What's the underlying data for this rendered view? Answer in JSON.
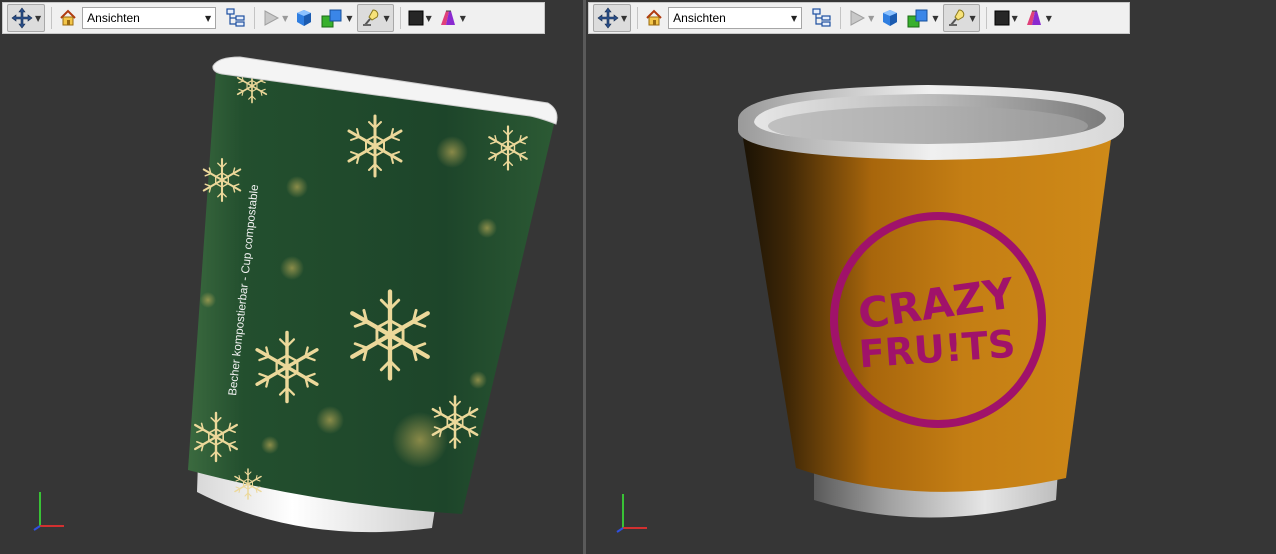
{
  "left_viewport": {
    "toolbar": {
      "view_select": {
        "value": "Ansichten"
      }
    },
    "cup": {
      "side_text": "Becher kompostierbar - Cup compostable"
    }
  },
  "right_viewport": {
    "toolbar": {
      "view_select": {
        "value": "Ansichten"
      }
    },
    "cup": {
      "logo_line1": "CRAZY",
      "logo_line2": "FRU!TS"
    }
  },
  "colors": {
    "viewport_bg": "#363636",
    "toolbar_bg": "#f0f0f0",
    "green_sleeve": "#1f4a2c",
    "snowflake_gold": "#e8d9a0",
    "orange_sleeve": "#c27a10",
    "logo_magenta": "#a0126a"
  },
  "icons": [
    "navigate-icon",
    "home-icon",
    "tree-icon",
    "play-icon",
    "cube-icon",
    "shading-icon",
    "light-icon",
    "background-icon",
    "material-icon"
  ]
}
